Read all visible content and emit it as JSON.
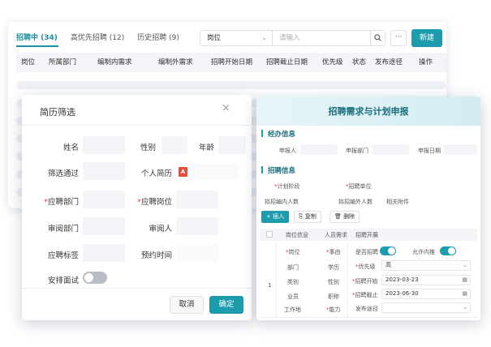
{
  "list": {
    "tabs": [
      {
        "label": "招聘中 (34)",
        "active": true
      },
      {
        "label": "高优先招聘 (12)",
        "active": false
      },
      {
        "label": "历史招聘 (9)",
        "active": false
      }
    ],
    "filter_select": "岗位",
    "search_placeholder": "请输入",
    "more_label": "···",
    "new_button": "新建",
    "columns": [
      "岗位",
      "所属部门",
      "编制内需求",
      "编制外需求",
      "招聘开始日期",
      "招聘截止日期",
      "优先级",
      "状态",
      "发布途径",
      "操作"
    ]
  },
  "resume_dialog": {
    "title": "简历筛选",
    "close": "×",
    "fields": {
      "name": "姓名",
      "gender": "性别",
      "age": "年龄",
      "passed": "筛选通过",
      "resume": "个人简历",
      "dept": "应聘部门",
      "position": "应聘岗位",
      "review_dept": "审阅部门",
      "reviewer": "审阅人",
      "tag": "应聘标签",
      "appoint_time": "预约时间",
      "arrange": "安排面试"
    },
    "required_mark": "*",
    "pdf_icon_text": "A",
    "arrange_toggle_on": false,
    "cancel": "取消",
    "confirm": "确定"
  },
  "plan_dialog": {
    "title": "招聘需求与计划申报",
    "section_manager": "经办信息",
    "applicant": "申报人",
    "applicant_dept": "申报部门",
    "apply_date": "申报日期",
    "section_recruit": "招聘信息",
    "plan_stage": "计划阶段",
    "recruit_unit": "招聘单位",
    "planned_in": "拟招编内人数",
    "planned_out": "拟招编外人数",
    "attachment": "相关附件",
    "insert": "+ 插入",
    "copy": "复制",
    "delete": "删除",
    "subtabs": [
      "岗位信息",
      "人员需求",
      "招聘开展"
    ],
    "row_index": "1",
    "col1": [
      "岗位",
      "部门",
      "类别",
      "业员",
      "工作地"
    ],
    "col2": [
      "事由",
      "学历",
      "性别",
      "职称",
      "能力"
    ],
    "col3_labels": [
      "是否招聘",
      "允许内推",
      "优先级",
      "招聘开始",
      "招聘截止",
      "发布途径"
    ],
    "priority_value": "高",
    "start_date": "2023-03-23",
    "end_date": "2023-06-30",
    "toggles_on": true
  }
}
